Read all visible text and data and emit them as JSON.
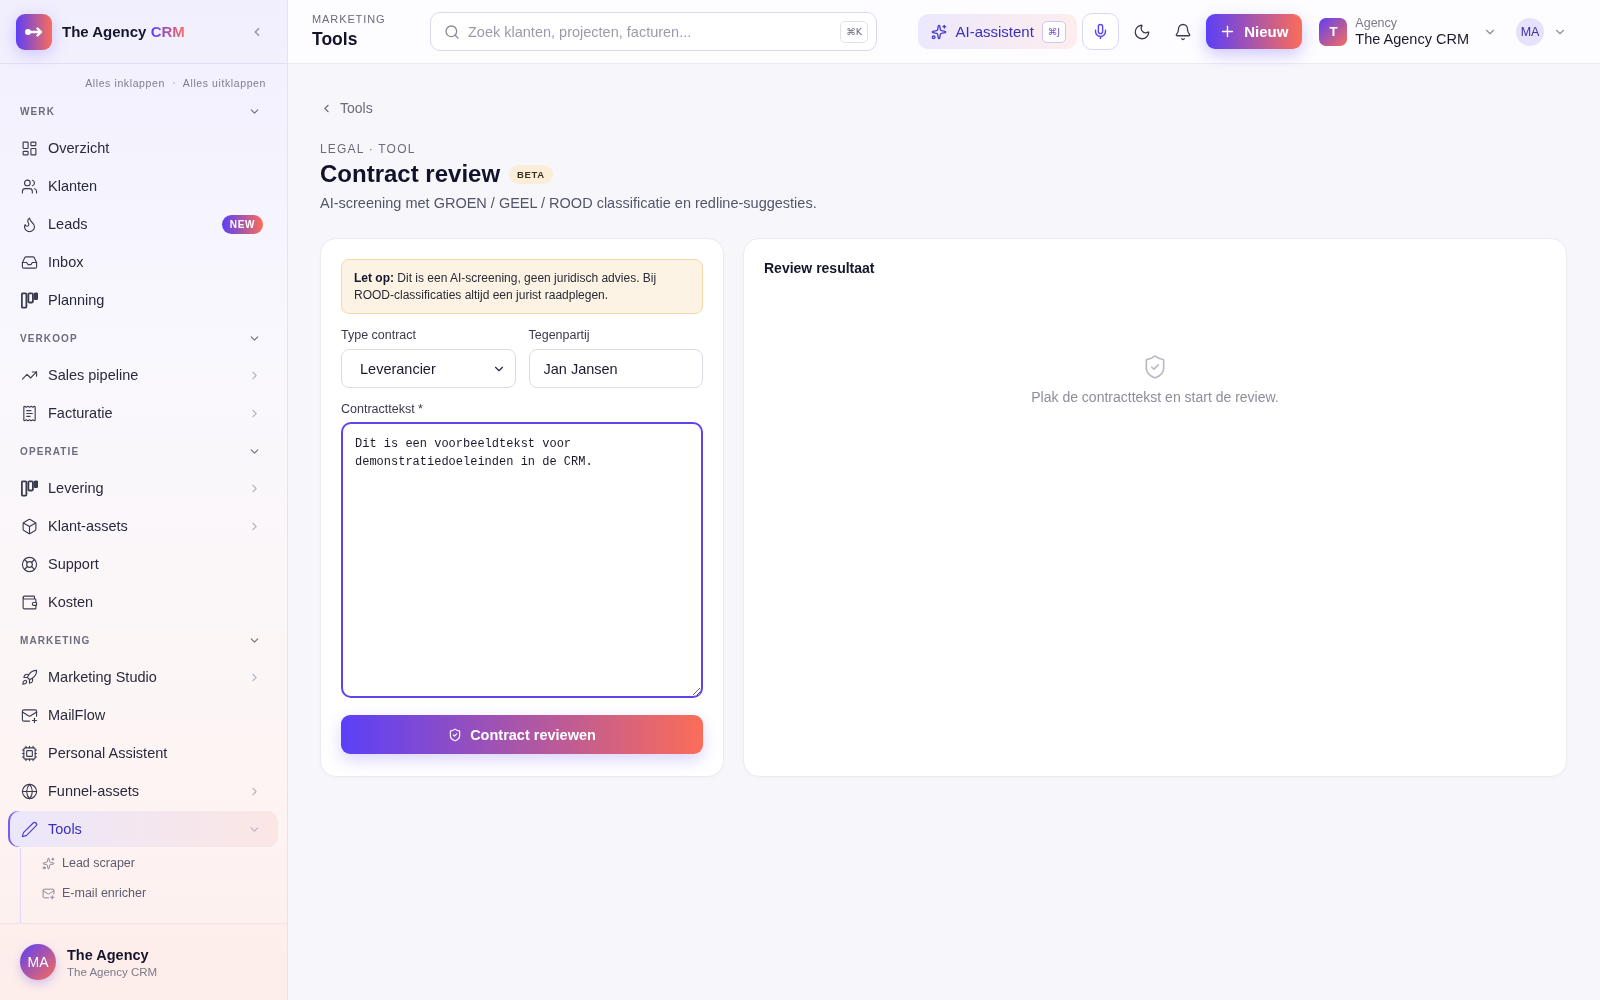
{
  "sidebar": {
    "brand": {
      "name": "The Agency",
      "accent": "CRM"
    },
    "collapse_links": [
      "Alles inklappen",
      "Alles uitklappen"
    ],
    "sections": [
      {
        "title": "WERK",
        "expanded": true,
        "items": [
          {
            "label": "Overzicht",
            "selected": false
          },
          {
            "label": "Klanten",
            "selected": false
          },
          {
            "label": "Leads",
            "selected": false,
            "badge": "NEW"
          },
          {
            "label": "Inbox",
            "selected": false
          },
          {
            "label": "Planning",
            "selected": false
          }
        ]
      },
      {
        "title": "VERKOOP",
        "expanded": true,
        "items": [
          {
            "label": "Sales pipeline",
            "selected": false,
            "expanded": false
          },
          {
            "label": "Facturatie",
            "selected": false,
            "expanded": false
          }
        ]
      },
      {
        "title": "OPERATIE",
        "expanded": true,
        "items": [
          {
            "label": "Levering",
            "selected": false,
            "expanded": false
          },
          {
            "label": "Klant-assets",
            "selected": false,
            "expanded": false
          },
          {
            "label": "Support",
            "selected": false
          },
          {
            "label": "Kosten",
            "selected": false
          }
        ]
      },
      {
        "title": "MARKETING",
        "expanded": true,
        "items": [
          {
            "label": "Marketing Studio",
            "selected": false,
            "expanded": false
          },
          {
            "label": "MailFlow",
            "selected": false
          },
          {
            "label": "Personal Assistent",
            "selected": false
          },
          {
            "label": "Funnel-assets",
            "selected": false,
            "expanded": false
          },
          {
            "label": "Tools",
            "selected": true,
            "expanded": true,
            "children": [
              {
                "label": "Lead scraper",
                "selected": false
              },
              {
                "label": "E-mail enricher",
                "selected": false
              }
            ]
          }
        ]
      }
    ],
    "account": {
      "initials": "MA",
      "name": "The Agency",
      "subtitle": "The Agency CRM"
    }
  },
  "topbar": {
    "section": "MARKETING",
    "title": "Tools",
    "search": {
      "placeholder": "Zoek klanten, projecten, facturen...",
      "shortcut": "⌘K"
    },
    "assistant": {
      "label": "AI-assistent",
      "shortcut": "⌘J"
    },
    "new_button": "Nieuw",
    "workspace": {
      "initial": "T",
      "caption": "Agency",
      "name": "The Agency CRM"
    },
    "user": {
      "initials": "MA"
    }
  },
  "page": {
    "breadcrumb": "Tools",
    "eyebrow": "LEGAL · TOOL",
    "title": "Contract review",
    "badge": "BETA",
    "description": "AI-screening met GROEN / GEEL / ROOD classificatie en redline-suggesties."
  },
  "form": {
    "notice": "**Let op:** Dit is een AI-screening, geen juridisch advies. Bij ROOD-classificaties altijd een jurist raadplegen.",
    "contract_type": {
      "label": "Type contract",
      "value": "Leverancier"
    },
    "counterparty": {
      "label": "Tegenpartij",
      "value": "Jan Jansen"
    },
    "contract_text": {
      "label": "Contracttekst *",
      "value": "Dit is een voorbeeldtekst voor demonstratiedoeleinden in de CRM.",
      "focused": true
    },
    "submit": "Contract reviewen"
  },
  "result": {
    "title": "Review resultaat",
    "empty_message": "Plak de contracttekst en start de review."
  }
}
